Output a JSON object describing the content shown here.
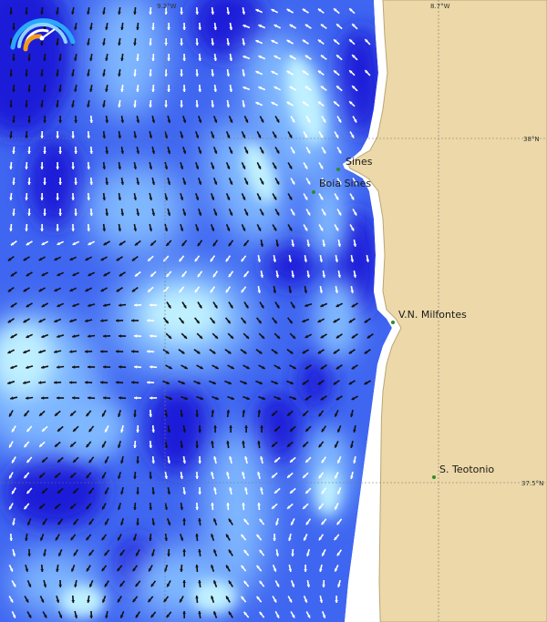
{
  "map": {
    "colors": {
      "land": "#ecd8a8",
      "coast_stroke": "#b9a677",
      "beach": "#ffffff",
      "sea_deep": "#1a1ad8",
      "sea_mid": "#3f66f0",
      "sea_light": "#7fb7ff",
      "sea_pale": "#bff0ff",
      "arrow_dark": "#111111",
      "arrow_light": "#ffffff",
      "gridline": "#777777",
      "place_dot": "#2e8b2e"
    },
    "gridlines": {
      "longitudes": [
        {
          "label": "9.2°W"
        },
        {
          "label": "8.7°W"
        }
      ],
      "latitudes": [
        {
          "label": "38°N"
        },
        {
          "label": "37.5°N"
        }
      ]
    },
    "places": [
      {
        "name": "Sines"
      },
      {
        "name": "Boia Sines"
      },
      {
        "name": "V.N. Milfontes"
      },
      {
        "name": "S. Teotonio"
      }
    ],
    "logo_icon": "gauge-logo-icon"
  }
}
